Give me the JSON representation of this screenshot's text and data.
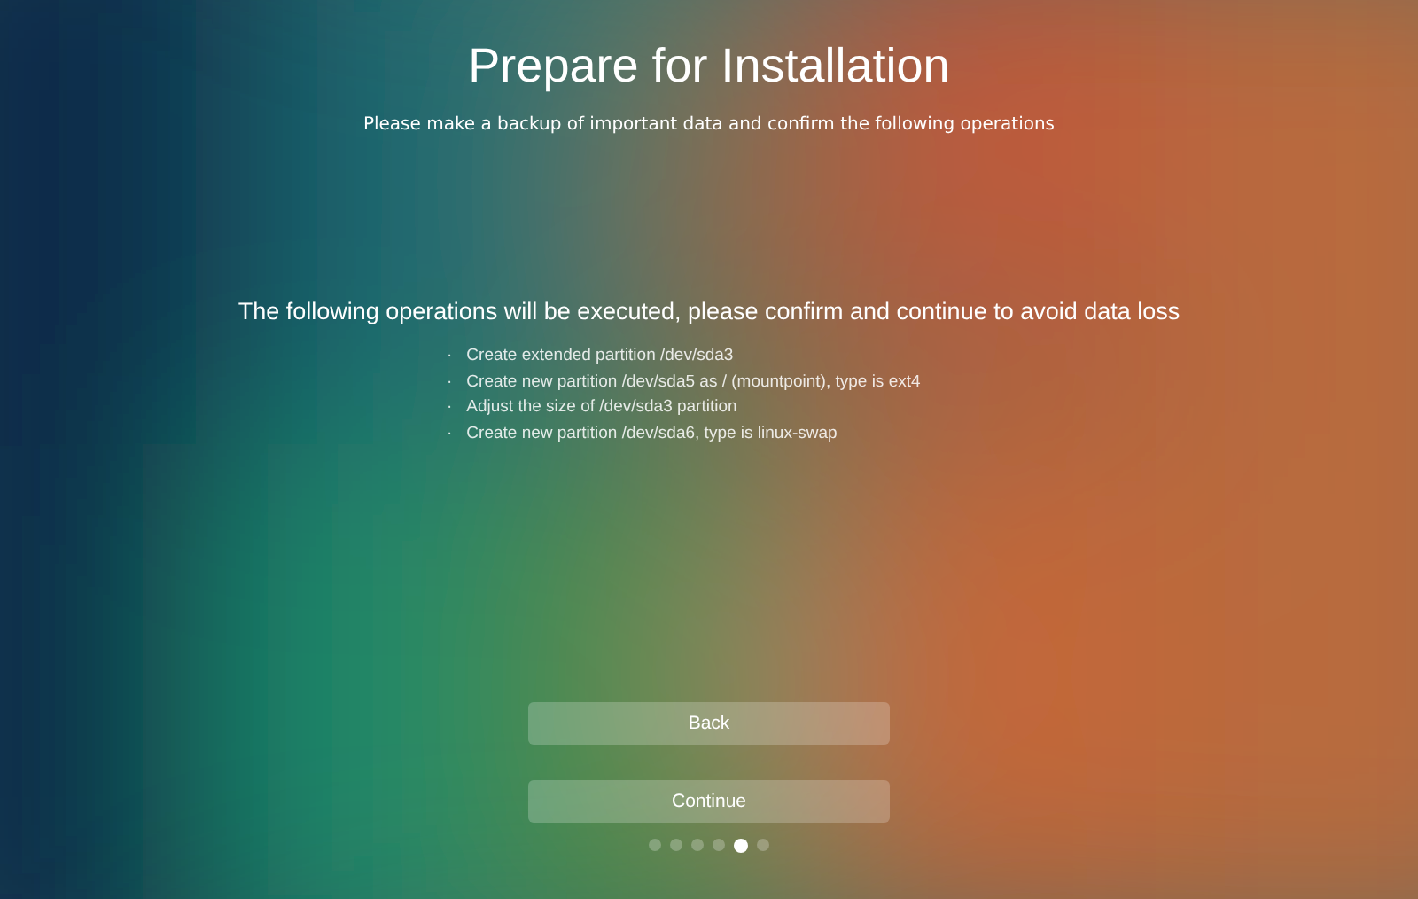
{
  "title": "Prepare for Installation",
  "subtitle": "Please make a backup of important data and confirm the following operations",
  "heading": "The following operations will be executed, please confirm and continue to avoid data loss",
  "operations": [
    {
      "bullet": "·",
      "text": "Create extended partition /dev/sda3"
    },
    {
      "bullet": "·",
      "text": "Create new partition /dev/sda5 as / (mountpoint), type is ext4"
    },
    {
      "bullet": "·",
      "text": "Adjust the size of /dev/sda3 partition"
    },
    {
      "bullet": "·",
      "text": "Create new partition /dev/sda6, type is linux-swap"
    }
  ],
  "buttons": [
    {
      "label": "Back"
    },
    {
      "label": "Continue"
    }
  ],
  "steps": [
    {
      "selected": false
    },
    {
      "selected": false
    },
    {
      "selected": false
    },
    {
      "selected": false
    },
    {
      "selected": true
    },
    {
      "selected": false
    }
  ]
}
